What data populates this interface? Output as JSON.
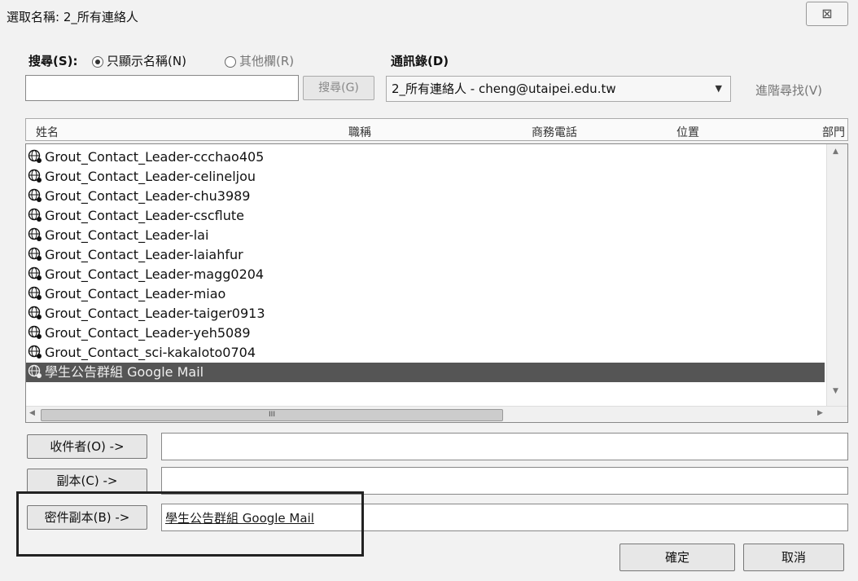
{
  "window": {
    "title": "選取名稱: 2_所有連絡人",
    "close_glyph": "⊠"
  },
  "search": {
    "label": "搜尋(S):",
    "radio_names_only": "只顯示名稱(N)",
    "radio_other_fields": "其他欄(R)",
    "button": "搜尋(G)",
    "query_value": ""
  },
  "addressbook": {
    "label": "通訊錄(D)",
    "selected": "2_所有連絡人 - cheng@utaipei.edu.tw",
    "advanced_find": "進階尋找(V)"
  },
  "columns": [
    "姓名",
    "職稱",
    "商務電話",
    "位置",
    "部門"
  ],
  "contacts": [
    "Grout_Contact_Leader-ccchao405",
    "Grout_Contact_Leader-celineljou",
    "Grout_Contact_Leader-chu3989",
    "Grout_Contact_Leader-cscflute",
    "Grout_Contact_Leader-lai",
    "Grout_Contact_Leader-laiahfur",
    "Grout_Contact_Leader-magg0204",
    "Grout_Contact_Leader-miao",
    "Grout_Contact_Leader-taiger0913",
    "Grout_Contact_Leader-yeh5089",
    "Grout_Contact_sci-kakaloto0704",
    "學生公告群組 Google Mail"
  ],
  "selected_contact_index": 11,
  "scrollbar": {
    "thumb_glyph": "III"
  },
  "recipients": {
    "to_button": "收件者(O) ->",
    "to_value": "",
    "cc_button": "副本(C) ->",
    "cc_value": "",
    "bcc_button": "密件副本(B) ->",
    "bcc_value": "學生公告群組 Google Mail"
  },
  "actions": {
    "ok": "確定",
    "cancel": "取消"
  },
  "colors": {
    "selection": "#555555",
    "highlight_border": "#222222"
  }
}
